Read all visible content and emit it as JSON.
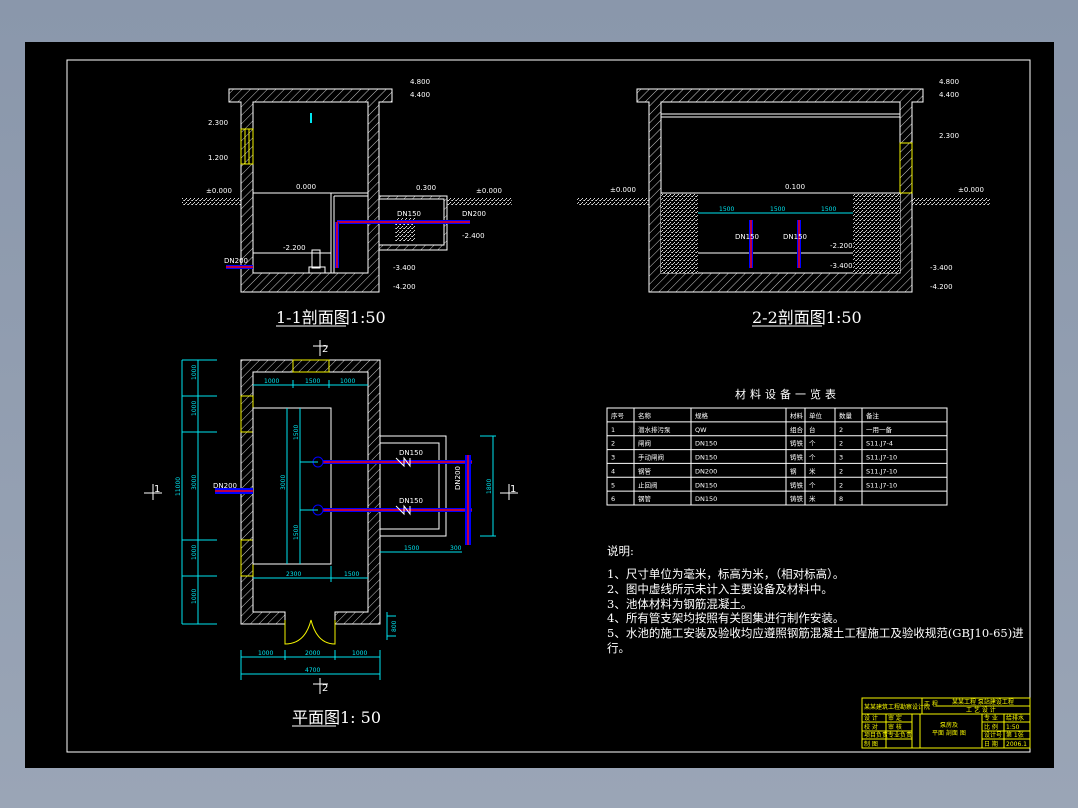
{
  "section11": {
    "title": "1-1剖面图1:50",
    "elevations": [
      "4.800",
      "4.400",
      "2.300",
      "1.200",
      "±0.000",
      "0.000",
      "0.300",
      "±0.000",
      "-2.200",
      "-3.400",
      "-4.200",
      "-2.400"
    ],
    "labels": {
      "valve": "DN150",
      "outlet": "DN200",
      "inlet": "DN200"
    }
  },
  "section22": {
    "title": "2-2剖面图1:50",
    "elevations": [
      "4.800",
      "4.400",
      "2.300",
      "±0.000",
      "0.100",
      "±0.000",
      "-2.200",
      "-3.400",
      "-3.400",
      "-4.200"
    ],
    "dims": [
      "1500",
      "1500",
      "1500"
    ],
    "labels": [
      "DN150",
      "DN150"
    ]
  },
  "plan": {
    "title": "平面图1: 50",
    "cut_marks": [
      "2",
      "2",
      "1",
      "1"
    ],
    "dims_left": [
      "1000",
      "1000",
      "3000",
      "1000",
      "1000",
      "11000"
    ],
    "dims_top": [
      "1000",
      "1500",
      "1000"
    ],
    "dims_bottom": [
      "1000",
      "2000",
      "1000",
      "4700"
    ],
    "dims_inner": [
      "2300",
      "1500",
      "3000",
      "1500",
      "1500"
    ],
    "dims_right": [
      "1500",
      "300",
      "1800",
      "800"
    ],
    "labels": {
      "valve1": "DN150",
      "valve2": "DN150",
      "inlet": "DN200",
      "outlet": "DN200"
    }
  },
  "table": {
    "title": "材料设备一览表",
    "headers": [
      "序号",
      "名称",
      "规格",
      "材料",
      "单位",
      "数量",
      "备注"
    ],
    "rows": [
      [
        "1",
        "潜水排污泵",
        "QW",
        "组合",
        "台",
        "2",
        "一用一备"
      ],
      [
        "2",
        "闸阀",
        "DN150",
        "铸铁",
        "个",
        "2",
        "S11.J7-4"
      ],
      [
        "3",
        "手动闸阀",
        "DN150",
        "铸铁",
        "个",
        "3",
        "S11.J7-10"
      ],
      [
        "4",
        "钢管",
        "DN200",
        "钢",
        "米",
        "2",
        "S11.J7-10"
      ],
      [
        "5",
        "止回阀",
        "DN150",
        "铸铁",
        "个",
        "2",
        "S11.J7-10"
      ],
      [
        "6",
        "钢管",
        "DN150",
        "铸铁",
        "米",
        "8",
        ""
      ]
    ]
  },
  "notes": {
    "heading": "说明:",
    "items": [
      "1、尺寸单位为毫米，标高为米，（相对标高）。",
      "2、图中虚线所示未计入主要设备及材料中。",
      "3、池体材料为钢筋混凝土。",
      "4、所有管支架均按照有关图集进行制作安装。",
      "5、水池的施工安装及验收均应遵照钢筋混凝土工程施工及验收规范(GBJ10-65)进",
      "行。"
    ]
  },
  "title_block": {
    "company": "某某建筑工程勘察设计院",
    "project_row1": "某某工程 泵站建设工程",
    "project_row2": "工 艺 设 计",
    "col_label": "工 程",
    "rows_left": [
      [
        "设 计",
        "审 定"
      ],
      [
        "校 对",
        "审 核"
      ],
      [
        "项目负责",
        "专业负责"
      ],
      [
        "制 图",
        ""
      ]
    ],
    "center": [
      "泵房及",
      "平面 剖面 图"
    ],
    "rows_right": [
      [
        "专 业",
        "给排水"
      ],
      [
        "比 例",
        "1:50"
      ],
      [
        "设计号",
        "第 1张"
      ],
      [
        "日 期",
        "2006.1"
      ]
    ]
  },
  "colors": {
    "background": "#000000",
    "line": "#ffffff",
    "dim": "#00e5f0",
    "frame": "#f5f500",
    "pipe_red": "#ff0000",
    "pipe_blue": "#0000ff"
  }
}
